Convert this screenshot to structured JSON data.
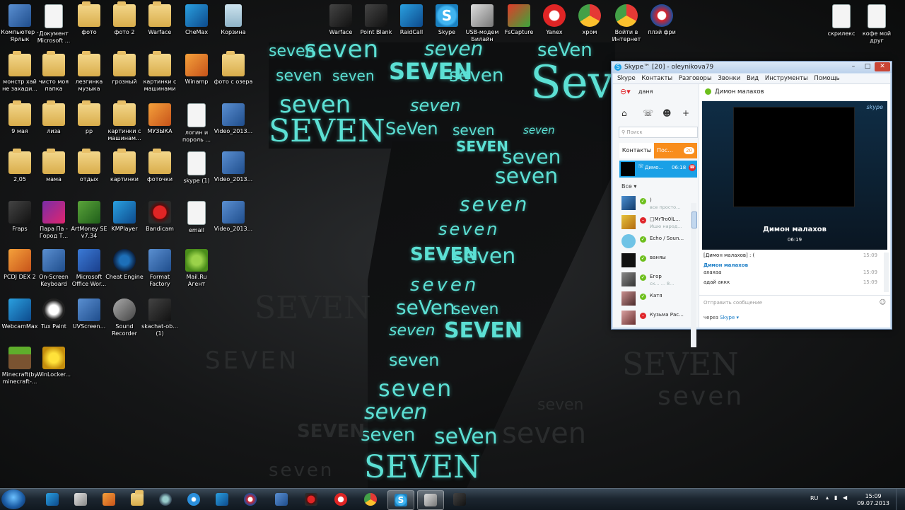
{
  "wallpaper_words": [
    "seven",
    "SEVEN",
    "Seven",
    "seVen",
    "sever",
    "SeVen",
    "seven",
    "seven"
  ],
  "desktop_icons": {
    "col1": [
      "Компьютер - Ярлык",
      "монстр хай не захади...",
      "9 мая",
      "2,05",
      "Fraps",
      "PCDJ DEX 2",
      "WebcamMax",
      "Minecraft(by minecraft-..."
    ],
    "col2": [
      "Документ Microsoft ...",
      "чисто моя папка",
      "лиза",
      "мама",
      "Пара Па - Город Т...",
      "On-Screen Keyboard",
      "Tux Paint",
      "WinLocker..."
    ],
    "col3": [
      "фото",
      "лезгинка музыка",
      "pp",
      "отдых",
      "ArtMoney SE v7.34",
      "Microsoft Office Wor...",
      "UVScreen..."
    ],
    "col4": [
      "фото 2",
      "грозный",
      "картинки с машинам...",
      "картинки",
      "KMPlayer",
      "Cheat Engine",
      "Sound Recorder"
    ],
    "col5": [
      "Warface",
      "картинки с машинами",
      "МУЗЫКА",
      "фоточки",
      "Bandicam",
      "Format Factory",
      "skachat-ob... (1)"
    ],
    "col6": [
      "CheMax",
      "Winamp",
      "логин и пороль ...",
      "skype (1)",
      "email",
      "Mail.Ru Агент"
    ],
    "col7": [
      "Корзина",
      "фото с озера",
      "Video_2013...",
      "Video_2013...",
      "Video_2013..."
    ],
    "top_row": [
      "Warface",
      "Point Blank",
      "RaidCall",
      "Skype",
      "USB-модем Билайн",
      "FsCapture",
      "Yanex",
      "хром",
      "Войти в Интернет",
      "плэй фри"
    ],
    "right": [
      "скрилекс",
      "кофе мой друг"
    ]
  },
  "skype": {
    "title": "Skype™ [20] - oleynikova79",
    "menu": [
      "Skype",
      "Контакты",
      "Разговоры",
      "Звонки",
      "Вид",
      "Инструменты",
      "Помощь"
    ],
    "user": "даня",
    "search_placeholder": "Поиск",
    "tab_contacts": "Контакты",
    "tab_recent": "Пос...",
    "recent_badge": "20",
    "active_call": {
      "name": "Димо...",
      "time": "06:18"
    },
    "filter": "Все",
    "contacts": [
      {
        "name": ")",
        "mood": "все просто..."
      },
      {
        "name": "□MrTro0lL...",
        "mood": "Ишю народ..."
      },
      {
        "name": "Echo / Soun...",
        "mood": ""
      },
      {
        "name": "ваняы",
        "mood": ""
      },
      {
        "name": "Егор",
        "mood": "ск... ... 8..."
      },
      {
        "name": "Катя",
        "mood": ""
      },
      {
        "name": "Кузьма Рас...",
        "mood": ""
      }
    ],
    "chat_header": "Димон малахов",
    "video_name": "Димон малахов",
    "video_time": "06:19",
    "chat": [
      {
        "text": "[Димон малахов] : (",
        "time": "15:09"
      },
      {
        "text": "Димон малахов",
        "time": ""
      },
      {
        "text": "ахахаа",
        "time": "15:09"
      },
      {
        "text": "адай аккк",
        "time": "15:09"
      }
    ],
    "input_placeholder": "Отправить сообщение",
    "via_label": "через",
    "via_value": "Skype"
  },
  "taskbar": {
    "lang": "RU",
    "time": "15:09",
    "date": "09.07.2013"
  }
}
